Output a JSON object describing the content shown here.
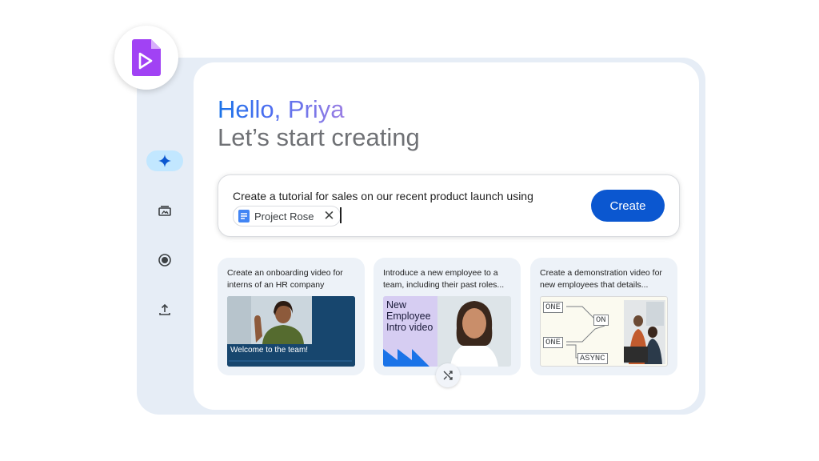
{
  "app": {
    "icon": "video-play-doc-icon"
  },
  "rail": [
    {
      "name": "sparkle-icon",
      "active": true
    },
    {
      "name": "media-library-icon",
      "active": false
    },
    {
      "name": "record-icon",
      "active": false
    },
    {
      "name": "upload-icon",
      "active": false
    }
  ],
  "greeting": {
    "hello": "Hello, Priya",
    "subtitle": "Let’s start creating"
  },
  "prompt": {
    "text": "Create a tutorial for sales on our recent product launch using",
    "chip_label": "Project Rose",
    "chip_icon": "docs-icon",
    "chip_close": "✕",
    "create_label": "Create"
  },
  "suggestions": [
    {
      "text": "Create an onboarding video for interns of an HR company",
      "thumb_caption": "Welcome to the team!"
    },
    {
      "text": "Introduce a new employee to a team, including their past roles...",
      "thumb_title": "New Employee Intro video"
    },
    {
      "text": "Create a demonstration video for new employees that details...",
      "diagram": {
        "one_top": "ONE",
        "on": "ON",
        "one_bottom": "ONE",
        "async": "ASYNC"
      }
    }
  ],
  "colors": {
    "accent": "#0b57d0",
    "frame": "#e6edf6",
    "chip_active": "#c2e7ff"
  }
}
